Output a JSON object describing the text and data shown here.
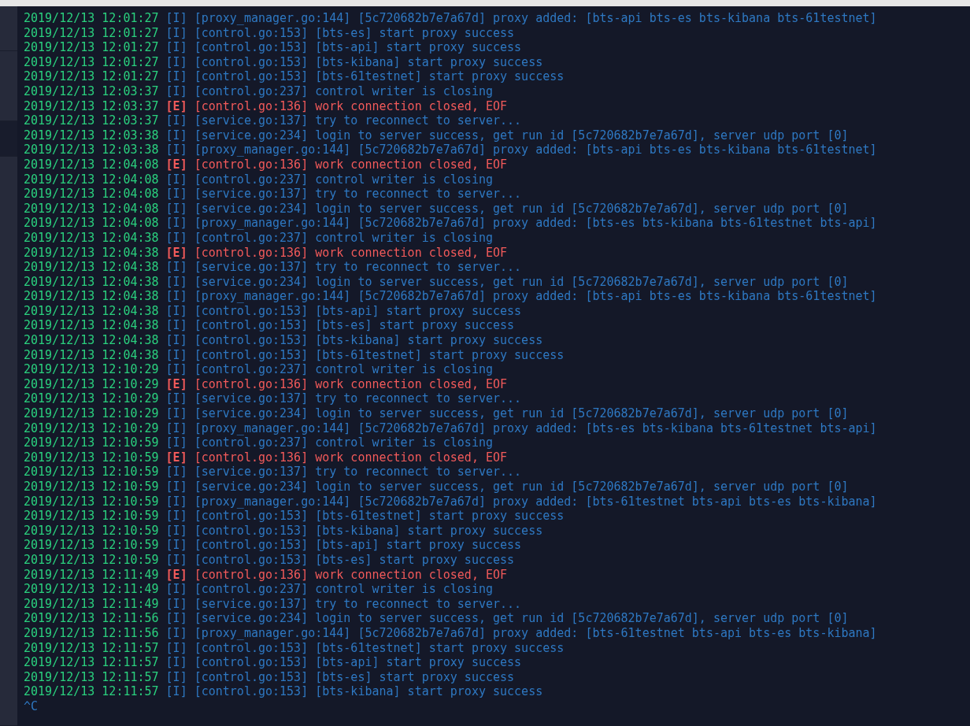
{
  "log_lines": [
    {
      "timestamp": "2019/12/13 12:01:27",
      "level": "[I]",
      "kind": "info",
      "message": "[proxy_manager.go:144] [5c720682b7e7a67d] proxy added: [bts-api bts-es bts-kibana bts-61testnet]"
    },
    {
      "timestamp": "2019/12/13 12:01:27",
      "level": "[I]",
      "kind": "info",
      "message": "[control.go:153] [bts-es] start proxy success"
    },
    {
      "timestamp": "2019/12/13 12:01:27",
      "level": "[I]",
      "kind": "info",
      "message": "[control.go:153] [bts-api] start proxy success"
    },
    {
      "timestamp": "2019/12/13 12:01:27",
      "level": "[I]",
      "kind": "info",
      "message": "[control.go:153] [bts-kibana] start proxy success"
    },
    {
      "timestamp": "2019/12/13 12:01:27",
      "level": "[I]",
      "kind": "info",
      "message": "[control.go:153] [bts-61testnet] start proxy success"
    },
    {
      "timestamp": "2019/12/13 12:03:37",
      "level": "[I]",
      "kind": "info",
      "message": "[control.go:237] control writer is closing"
    },
    {
      "timestamp": "2019/12/13 12:03:37",
      "level": "[E]",
      "kind": "error",
      "message": "[control.go:136] work connection closed, EOF"
    },
    {
      "timestamp": "2019/12/13 12:03:37",
      "level": "[I]",
      "kind": "info",
      "message": "[service.go:137] try to reconnect to server..."
    },
    {
      "timestamp": "2019/12/13 12:03:38",
      "level": "[I]",
      "kind": "info",
      "message": "[service.go:234] login to server success, get run id [5c720682b7e7a67d], server udp port [0]"
    },
    {
      "timestamp": "2019/12/13 12:03:38",
      "level": "[I]",
      "kind": "info",
      "message": "[proxy_manager.go:144] [5c720682b7e7a67d] proxy added: [bts-api bts-es bts-kibana bts-61testnet]"
    },
    {
      "timestamp": "2019/12/13 12:04:08",
      "level": "[E]",
      "kind": "error",
      "message": "[control.go:136] work connection closed, EOF"
    },
    {
      "timestamp": "2019/12/13 12:04:08",
      "level": "[I]",
      "kind": "info",
      "message": "[control.go:237] control writer is closing"
    },
    {
      "timestamp": "2019/12/13 12:04:08",
      "level": "[I]",
      "kind": "info",
      "message": "[service.go:137] try to reconnect to server..."
    },
    {
      "timestamp": "2019/12/13 12:04:08",
      "level": "[I]",
      "kind": "info",
      "message": "[service.go:234] login to server success, get run id [5c720682b7e7a67d], server udp port [0]"
    },
    {
      "timestamp": "2019/12/13 12:04:08",
      "level": "[I]",
      "kind": "info",
      "message": "[proxy_manager.go:144] [5c720682b7e7a67d] proxy added: [bts-es bts-kibana bts-61testnet bts-api]"
    },
    {
      "timestamp": "2019/12/13 12:04:38",
      "level": "[I]",
      "kind": "info",
      "message": "[control.go:237] control writer is closing"
    },
    {
      "timestamp": "2019/12/13 12:04:38",
      "level": "[E]",
      "kind": "error",
      "message": "[control.go:136] work connection closed, EOF"
    },
    {
      "timestamp": "2019/12/13 12:04:38",
      "level": "[I]",
      "kind": "info",
      "message": "[service.go:137] try to reconnect to server..."
    },
    {
      "timestamp": "2019/12/13 12:04:38",
      "level": "[I]",
      "kind": "info",
      "message": "[service.go:234] login to server success, get run id [5c720682b7e7a67d], server udp port [0]"
    },
    {
      "timestamp": "2019/12/13 12:04:38",
      "level": "[I]",
      "kind": "info",
      "message": "[proxy_manager.go:144] [5c720682b7e7a67d] proxy added: [bts-api bts-es bts-kibana bts-61testnet]"
    },
    {
      "timestamp": "2019/12/13 12:04:38",
      "level": "[I]",
      "kind": "info",
      "message": "[control.go:153] [bts-api] start proxy success"
    },
    {
      "timestamp": "2019/12/13 12:04:38",
      "level": "[I]",
      "kind": "info",
      "message": "[control.go:153] [bts-es] start proxy success"
    },
    {
      "timestamp": "2019/12/13 12:04:38",
      "level": "[I]",
      "kind": "info",
      "message": "[control.go:153] [bts-kibana] start proxy success"
    },
    {
      "timestamp": "2019/12/13 12:04:38",
      "level": "[I]",
      "kind": "info",
      "message": "[control.go:153] [bts-61testnet] start proxy success"
    },
    {
      "timestamp": "2019/12/13 12:10:29",
      "level": "[I]",
      "kind": "info",
      "message": "[control.go:237] control writer is closing"
    },
    {
      "timestamp": "2019/12/13 12:10:29",
      "level": "[E]",
      "kind": "error",
      "message": "[control.go:136] work connection closed, EOF"
    },
    {
      "timestamp": "2019/12/13 12:10:29",
      "level": "[I]",
      "kind": "info",
      "message": "[service.go:137] try to reconnect to server..."
    },
    {
      "timestamp": "2019/12/13 12:10:29",
      "level": "[I]",
      "kind": "info",
      "message": "[service.go:234] login to server success, get run id [5c720682b7e7a67d], server udp port [0]"
    },
    {
      "timestamp": "2019/12/13 12:10:29",
      "level": "[I]",
      "kind": "info",
      "message": "[proxy_manager.go:144] [5c720682b7e7a67d] proxy added: [bts-es bts-kibana bts-61testnet bts-api]"
    },
    {
      "timestamp": "2019/12/13 12:10:59",
      "level": "[I]",
      "kind": "info",
      "message": "[control.go:237] control writer is closing"
    },
    {
      "timestamp": "2019/12/13 12:10:59",
      "level": "[E]",
      "kind": "error",
      "message": "[control.go:136] work connection closed, EOF"
    },
    {
      "timestamp": "2019/12/13 12:10:59",
      "level": "[I]",
      "kind": "info",
      "message": "[service.go:137] try to reconnect to server..."
    },
    {
      "timestamp": "2019/12/13 12:10:59",
      "level": "[I]",
      "kind": "info",
      "message": "[service.go:234] login to server success, get run id [5c720682b7e7a67d], server udp port [0]"
    },
    {
      "timestamp": "2019/12/13 12:10:59",
      "level": "[I]",
      "kind": "info",
      "message": "[proxy_manager.go:144] [5c720682b7e7a67d] proxy added: [bts-61testnet bts-api bts-es bts-kibana]"
    },
    {
      "timestamp": "2019/12/13 12:10:59",
      "level": "[I]",
      "kind": "info",
      "message": "[control.go:153] [bts-61testnet] start proxy success"
    },
    {
      "timestamp": "2019/12/13 12:10:59",
      "level": "[I]",
      "kind": "info",
      "message": "[control.go:153] [bts-kibana] start proxy success"
    },
    {
      "timestamp": "2019/12/13 12:10:59",
      "level": "[I]",
      "kind": "info",
      "message": "[control.go:153] [bts-api] start proxy success"
    },
    {
      "timestamp": "2019/12/13 12:10:59",
      "level": "[I]",
      "kind": "info",
      "message": "[control.go:153] [bts-es] start proxy success"
    },
    {
      "timestamp": "2019/12/13 12:11:49",
      "level": "[E]",
      "kind": "error",
      "message": "[control.go:136] work connection closed, EOF"
    },
    {
      "timestamp": "2019/12/13 12:11:49",
      "level": "[I]",
      "kind": "info",
      "message": "[control.go:237] control writer is closing"
    },
    {
      "timestamp": "2019/12/13 12:11:49",
      "level": "[I]",
      "kind": "info",
      "message": "[service.go:137] try to reconnect to server..."
    },
    {
      "timestamp": "2019/12/13 12:11:56",
      "level": "[I]",
      "kind": "info",
      "message": "[service.go:234] login to server success, get run id [5c720682b7e7a67d], server udp port [0]"
    },
    {
      "timestamp": "2019/12/13 12:11:56",
      "level": "[I]",
      "kind": "info",
      "message": "[proxy_manager.go:144] [5c720682b7e7a67d] proxy added: [bts-61testnet bts-api bts-es bts-kibana]"
    },
    {
      "timestamp": "2019/12/13 12:11:57",
      "level": "[I]",
      "kind": "info",
      "message": "[control.go:153] [bts-61testnet] start proxy success"
    },
    {
      "timestamp": "2019/12/13 12:11:57",
      "level": "[I]",
      "kind": "info",
      "message": "[control.go:153] [bts-api] start proxy success"
    },
    {
      "timestamp": "2019/12/13 12:11:57",
      "level": "[I]",
      "kind": "info",
      "message": "[control.go:153] [bts-es] start proxy success"
    },
    {
      "timestamp": "2019/12/13 12:11:57",
      "level": "[I]",
      "kind": "info",
      "message": "[control.go:153] [bts-kibana] start proxy success"
    }
  ],
  "prompt_input": "^C"
}
